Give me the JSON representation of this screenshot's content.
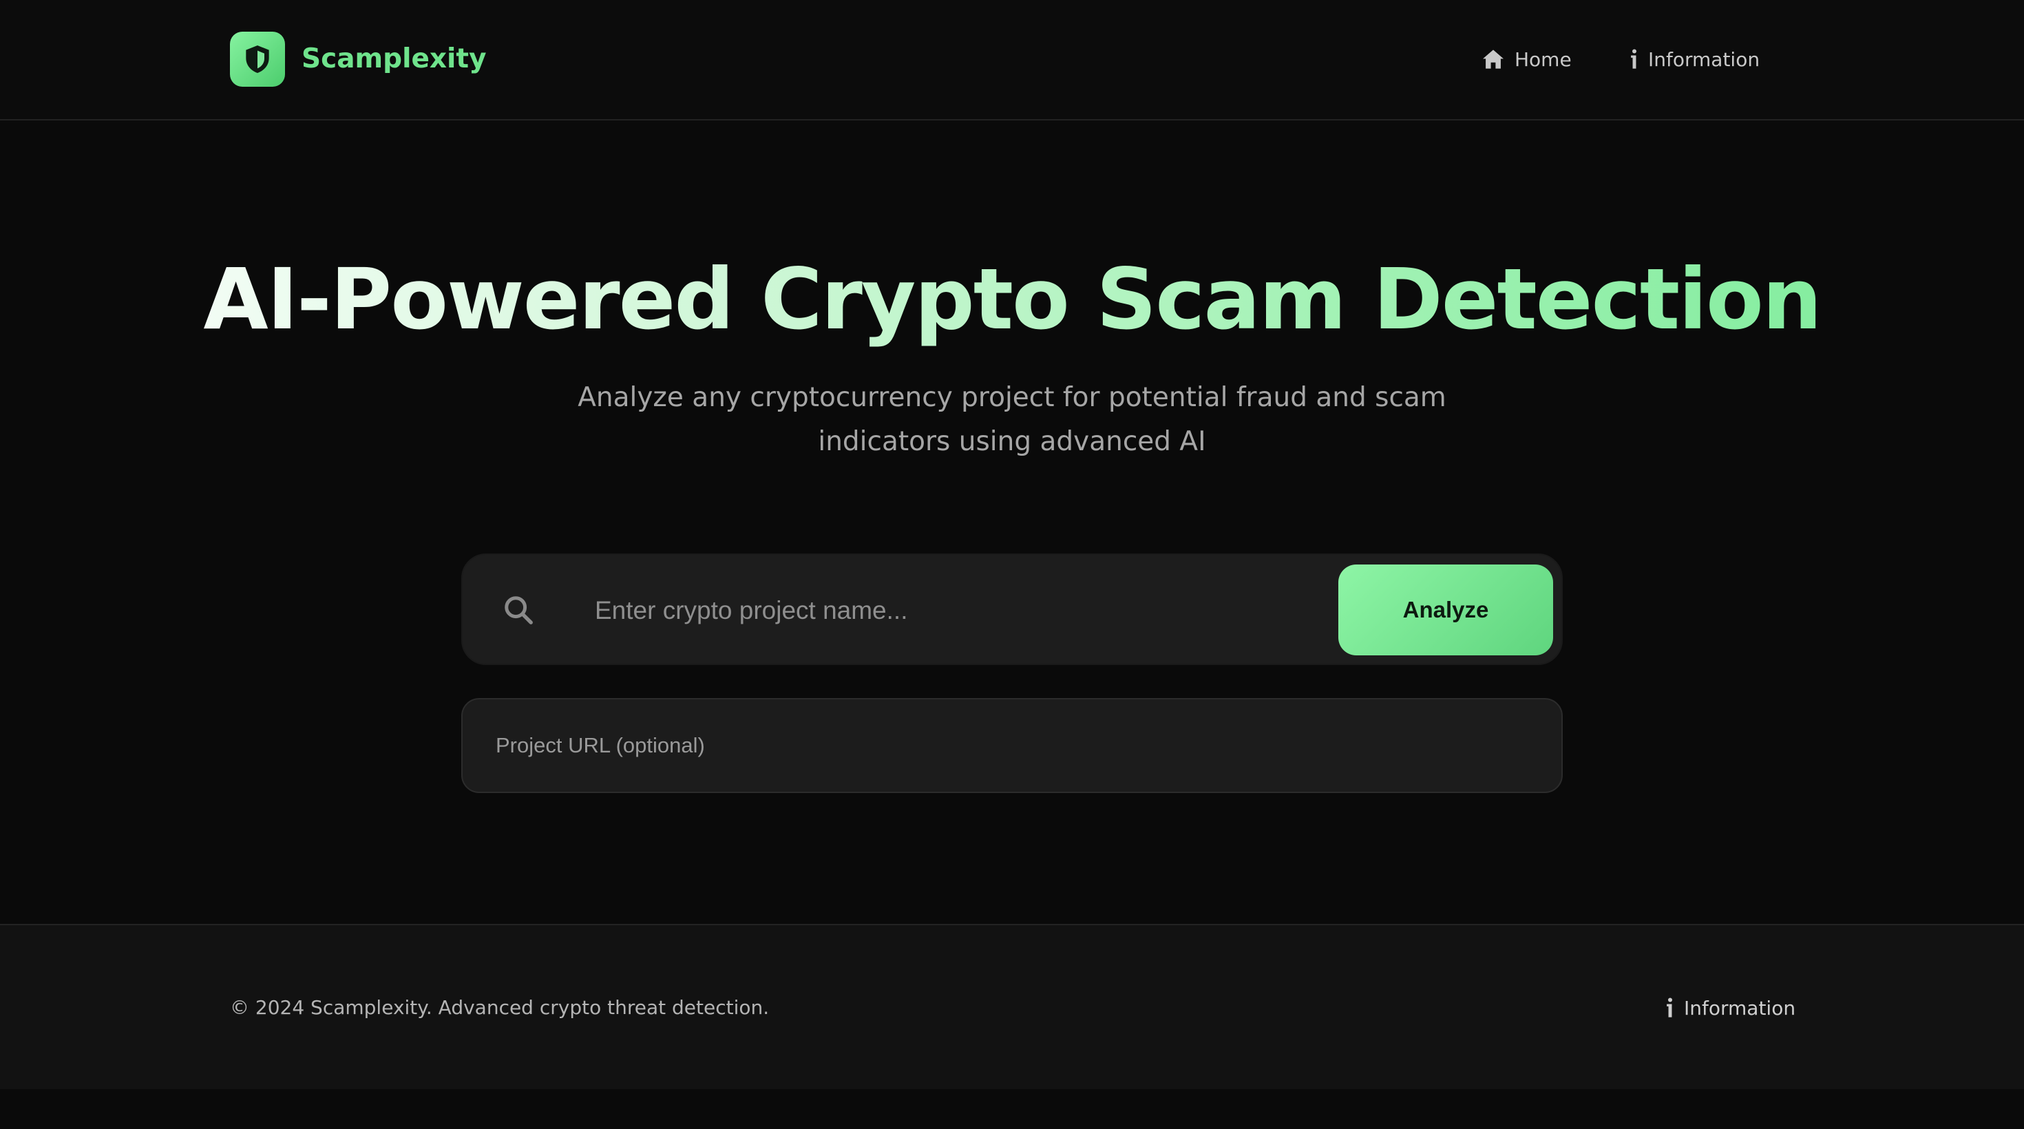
{
  "header": {
    "logo_text": "Scamplexity",
    "nav": {
      "home": "Home",
      "information": "Information"
    }
  },
  "hero": {
    "title": "AI-Powered Crypto Scam Detection",
    "subtitle": "Analyze any cryptocurrency project for potential fraud and scam indicators using advanced AI"
  },
  "search": {
    "placeholder": "Enter crypto project name...",
    "value": "",
    "button_label": "Analyze",
    "url_placeholder": "Project URL (optional)",
    "url_value": ""
  },
  "footer": {
    "copyright": "© 2024 Scamplexity. Advanced crypto threat detection.",
    "information": "Information"
  },
  "icons": {
    "logo": "shield-icon",
    "home": "home-icon",
    "information": "info-icon",
    "search": "search-icon"
  },
  "colors": {
    "background": "#0a0a0a",
    "accent": "#6fe38c",
    "accent_gradient_start": "#8ef5a6",
    "accent_gradient_end": "#5fd57e",
    "surface": "#1d1d1d"
  }
}
